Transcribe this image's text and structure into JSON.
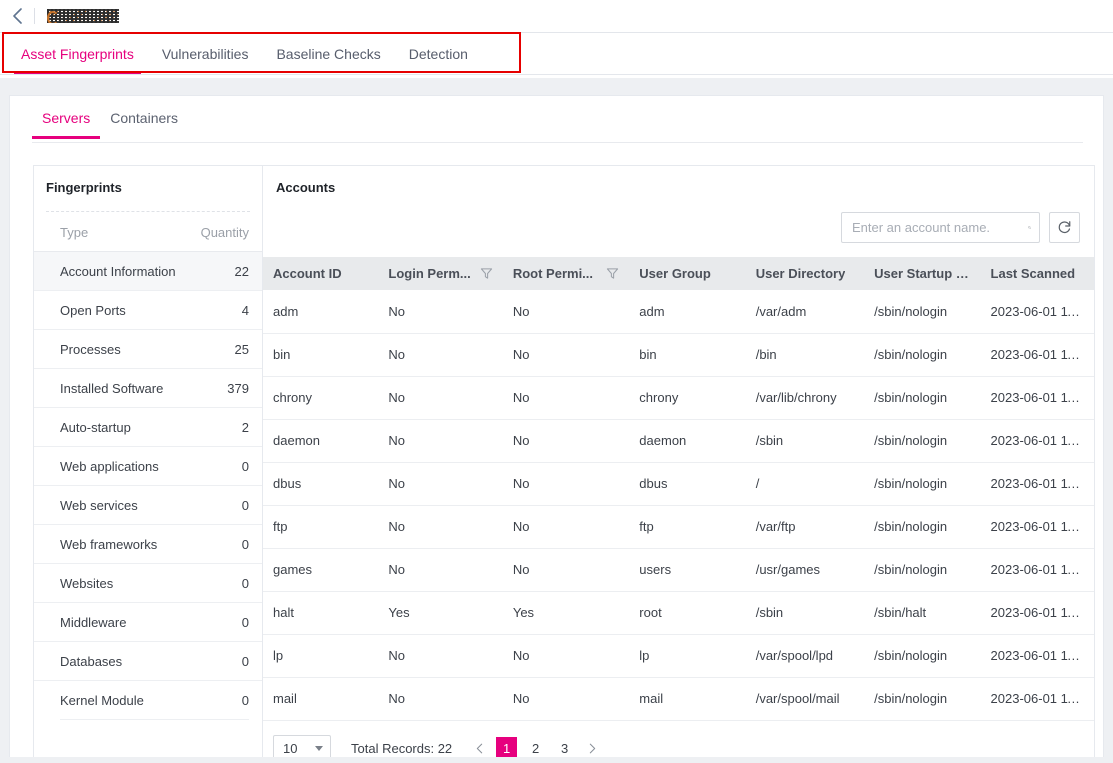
{
  "topbar": {
    "back_icon": "chevron-left-icon",
    "title": "",
    "title_redacted": true
  },
  "main_tabs": [
    {
      "label": "Asset Fingerprints",
      "active": true
    },
    {
      "label": "Vulnerabilities",
      "active": false
    },
    {
      "label": "Baseline Checks",
      "active": false
    },
    {
      "label": "Detection",
      "active": false
    }
  ],
  "annotation": {
    "type": "red-rectangle",
    "color": "#e60000"
  },
  "sub_tabs": [
    {
      "label": "Servers",
      "active": true
    },
    {
      "label": "Containers",
      "active": false
    }
  ],
  "sidebar": {
    "title": "Fingerprints",
    "columns": {
      "type": "Type",
      "quantity": "Quantity"
    },
    "items": [
      {
        "label": "Account Information",
        "quantity": "22",
        "selected": true
      },
      {
        "label": "Open Ports",
        "quantity": "4",
        "selected": false
      },
      {
        "label": "Processes",
        "quantity": "25",
        "selected": false
      },
      {
        "label": "Installed Software",
        "quantity": "379",
        "selected": false
      },
      {
        "label": "Auto-startup",
        "quantity": "2",
        "selected": false
      },
      {
        "label": "Web applications",
        "quantity": "0",
        "selected": false
      },
      {
        "label": "Web services",
        "quantity": "0",
        "selected": false
      },
      {
        "label": "Web frameworks",
        "quantity": "0",
        "selected": false
      },
      {
        "label": "Websites",
        "quantity": "0",
        "selected": false
      },
      {
        "label": "Middleware",
        "quantity": "0",
        "selected": false
      },
      {
        "label": "Databases",
        "quantity": "0",
        "selected": false
      },
      {
        "label": "Kernel Module",
        "quantity": "0",
        "selected": false
      }
    ]
  },
  "main": {
    "title": "Accounts",
    "search": {
      "placeholder": "Enter an account name.",
      "value": "",
      "icon": "search-icon"
    },
    "refresh": {
      "icon": "refresh-icon",
      "label": ""
    },
    "table": {
      "columns": [
        {
          "label": "Account ID",
          "filter": false
        },
        {
          "label": "Login Perm...",
          "filter": true
        },
        {
          "label": "Root Permi...",
          "filter": true
        },
        {
          "label": "User Group",
          "filter": false
        },
        {
          "label": "User Directory",
          "filter": false
        },
        {
          "label": "User Startup S...",
          "filter": false
        },
        {
          "label": "Last Scanned",
          "filter": false
        }
      ],
      "rows": [
        [
          "adm",
          "No",
          "No",
          "adm",
          "/var/adm",
          "/sbin/nologin",
          "2023-06-01 11:..."
        ],
        [
          "bin",
          "No",
          "No",
          "bin",
          "/bin",
          "/sbin/nologin",
          "2023-06-01 11:..."
        ],
        [
          "chrony",
          "No",
          "No",
          "chrony",
          "/var/lib/chrony",
          "/sbin/nologin",
          "2023-06-01 11:..."
        ],
        [
          "daemon",
          "No",
          "No",
          "daemon",
          "/sbin",
          "/sbin/nologin",
          "2023-06-01 11:..."
        ],
        [
          "dbus",
          "No",
          "No",
          "dbus",
          "/",
          "/sbin/nologin",
          "2023-06-01 11:..."
        ],
        [
          "ftp",
          "No",
          "No",
          "ftp",
          "/var/ftp",
          "/sbin/nologin",
          "2023-06-01 11:..."
        ],
        [
          "games",
          "No",
          "No",
          "users",
          "/usr/games",
          "/sbin/nologin",
          "2023-06-01 11:..."
        ],
        [
          "halt",
          "Yes",
          "Yes",
          "root",
          "/sbin",
          "/sbin/halt",
          "2023-06-01 11:..."
        ],
        [
          "lp",
          "No",
          "No",
          "lp",
          "/var/spool/lpd",
          "/sbin/nologin",
          "2023-06-01 11:..."
        ],
        [
          "mail",
          "No",
          "No",
          "mail",
          "/var/spool/mail",
          "/sbin/nologin",
          "2023-06-01 11:..."
        ]
      ]
    },
    "pagination": {
      "page_size": "10",
      "total_label": "Total Records: 22",
      "pages": [
        "1",
        "2",
        "3"
      ],
      "current_page": "1",
      "prev_icon": "chevron-left-icon",
      "next_icon": "chevron-right-icon"
    }
  },
  "colors": {
    "accent": "#e6007e",
    "annotation": "#e60000",
    "header_bg": "#e8eaec",
    "page_bg": "#eef0f3"
  }
}
